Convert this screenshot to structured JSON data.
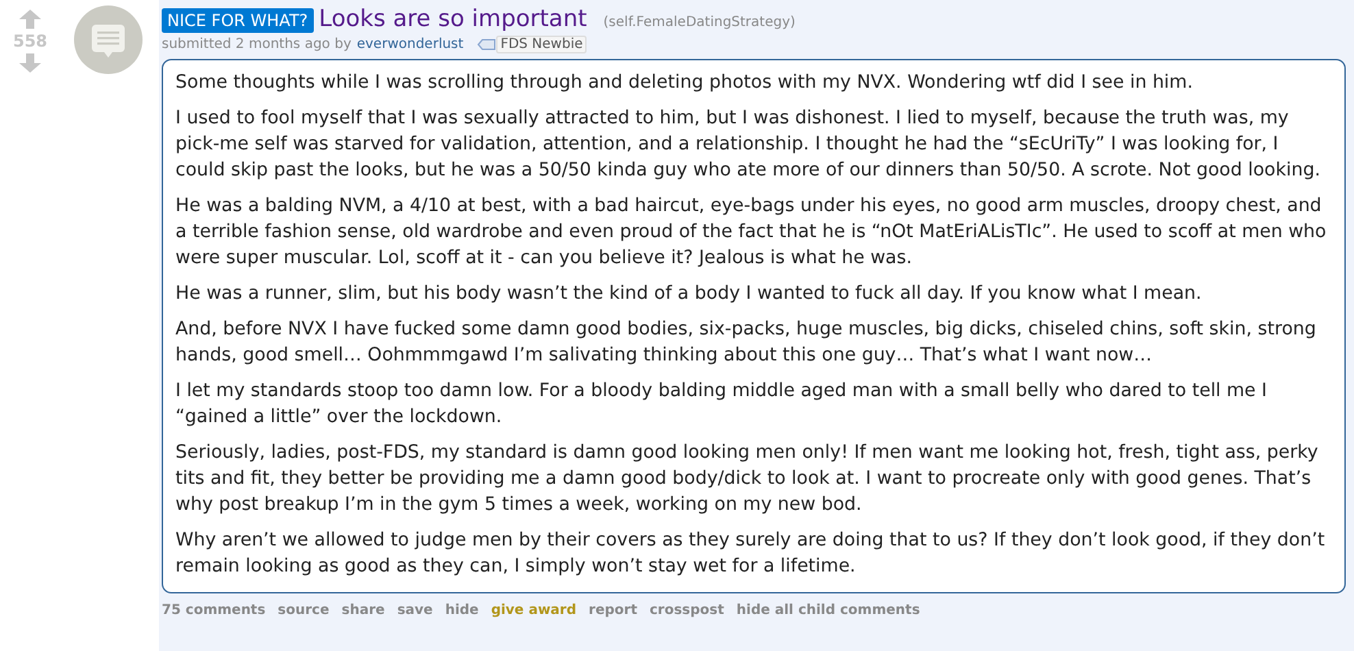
{
  "post": {
    "score": "558",
    "flair": "NICE FOR WHAT?",
    "title": "Looks are so important",
    "domain": "(self.FemaleDatingStrategy)",
    "tagline": {
      "prefix": "submitted 2 months ago by",
      "author": "everwonderlust",
      "user_flair": "FDS Newbie"
    },
    "paragraphs": [
      "Some thoughts while I was scrolling through and deleting photos with my NVX. Wondering wtf did I see in him.",
      "I used to fool myself that I was sexually attracted to him, but I was dishonest. I lied to myself, because the truth was, my pick-me self was starved for validation, attention, and a relationship. I thought he had the “sEcUriTy” I was looking for, I could skip past the looks, but he was a 50/50 kinda guy who ate more of our dinners than 50/50. A scrote. Not good looking.",
      "He was a balding NVM, a 4/10 at best, with a bad haircut, eye-bags under his eyes, no good arm muscles, droopy chest, and a terrible fashion sense, old wardrobe and even proud of the fact that he is “nOt MatEriALisTIc”. He used to scoff at men who were super muscular. Lol, scoff at it - can you believe it? Jealous is what he was.",
      "He was a runner, slim, but his body wasn’t the kind of a body I wanted to fuck all day. If you know what I mean.",
      "And, before NVX I have fucked some damn good bodies, six-packs, huge muscles, big dicks, chiseled chins, soft skin, strong hands, good smell… Oohmmmgawd I’m salivating thinking about this one guy… That’s what I want now…",
      "I let my standards stoop too damn low. For a bloody balding middle aged man with a small belly who dared to tell me I “gained a little” over the lockdown.",
      "Seriously, ladies, post-FDS, my standard is damn good looking men only! If men want me looking hot, fresh, tight ass, perky tits and fit, they better be providing me a damn good body/dick to look at. I want to procreate only with good genes. That’s why post breakup I’m in the gym 5 times a week, working on my new bod.",
      "Why aren’t we allowed to judge men by their covers as they surely are doing that to us? If they don’t look good, if they don’t remain looking as good as they can, I simply won’t stay wet for a lifetime."
    ],
    "actions": [
      {
        "label": "75 comments",
        "kind": "plain"
      },
      {
        "label": "source",
        "kind": "plain"
      },
      {
        "label": "share",
        "kind": "plain"
      },
      {
        "label": "save",
        "kind": "plain"
      },
      {
        "label": "hide",
        "kind": "plain"
      },
      {
        "label": "give award",
        "kind": "award"
      },
      {
        "label": "report",
        "kind": "plain"
      },
      {
        "label": "crosspost",
        "kind": "plain"
      },
      {
        "label": "hide all child comments",
        "kind": "plain"
      }
    ]
  }
}
